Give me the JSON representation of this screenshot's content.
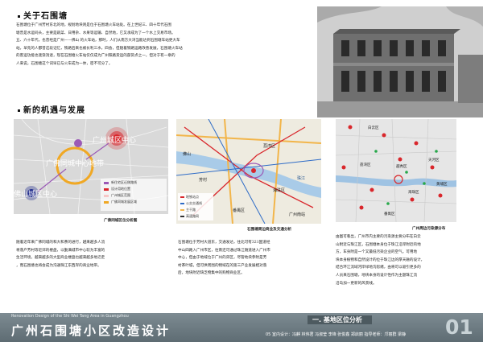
{
  "about": {
    "title": "关于石围塘",
    "paragraph": [
      "石围塘位于广州芳村东北的地，规划地块则是位于石围塘火车站处。在上世纪三、四十年代石围",
      "塘曾是水运码头，主要是蔬菜、日用杂、水果等运输、自然地，它又承成为了一个水上交易市场。",
      "五、六十年代，也曾经是广州——佛山 的火车站，那时，人们从南方大湾当能达到石围塘车站更大车",
      "站，早先的人都曾这段记忆，铁路后来也被长利三水，四会，但随着铁路运路改善发展，石围塘火车站",
      "的客运功能也逐渐消退，现在石围塘火车站仅仅成为广州铁路货运的部货点之一，但对于有一章的",
      "人来说，石围塘这个词早已与火车成为一体，密不可分了。"
    ]
  },
  "development": {
    "title": "新的机遇与发展"
  },
  "map1": {
    "labels": {
      "guangzhou_center": "广州城区中心",
      "foshan_center": "佛山城区中心",
      "belt": "广佛同城中心地带"
    },
    "legend": [
      "新住宅区迁移路线",
      "设计用地位置",
      "广州城区范围",
      "广佛同城发展区域"
    ],
    "caption": "广佛同城区位分析图",
    "colors": {
      "red": "#d9262b",
      "blue": "#1f2a8c",
      "yellow": "#f0a824",
      "purple": "#9b59b6"
    }
  },
  "map2": {
    "labels": [
      "芳村",
      "荔湾区",
      "海珠区",
      "佛山",
      "番禺区",
      "广州南站",
      "珠江"
    ],
    "legend": [
      "地铁站点",
      "公交交通线",
      "主干路",
      "高速路网"
    ],
    "caption": "石围塘周边商业及交通分析"
  },
  "map3": {
    "caption": "广州周边污染源分布",
    "labels": [
      "白云区",
      "荔湾区",
      "越秀区",
      "天河区",
      "海珠区",
      "黄埔区",
      "番禺区"
    ]
  },
  "texts": {
    "col1": [
      "随着近年来广佛同城的和大和茶的进行，越来越多人流",
      "将落户芳村等近郊的楼盘，以勤满城市中心较为丰富的",
      "生活环境，越来越多的大型商业楼盘也越来越多地迁走",
      "，而石围塘也将会成为沟通珠江东西岸的商业地带。"
    ],
    "col2": [
      "石围塘位于芳村大道东，交通发达，往北可有321国道经",
      "中山四路入广州市区，往南还可通过珠江隧道进入广州市",
      "中心，但由于地域位于广州的郊区，尽管地块参附是芳",
      "村茶叶城，但可供周围的物域在的第三产业发展相对落",
      "后，地块附近缺乏物集中的购物商业区。"
    ],
    "col3": [
      "由图可看出，广州市内主要的污染源主要分布在白云",
      "山附近与珠江区，石围塘本身位于珠江沿岸附近的地",
      "方，车身附是一个又最低污染企业的空气。可用地",
      "块本身植物和自然设计的位于珠江边的厚天融的设计，",
      "结合环江流域河岸绿地沟思绪，由将可以吸引更多的",
      "人员来石围塘，地块本身的设计性作为主题珠江流",
      "沿岛加一更新的风景线。"
    ]
  },
  "footer": {
    "title": "广州石围塘小区改造设计",
    "subtitle_en": "Renovation Design of the Shi Wei Tang Area in Guangzhou",
    "tag": "一. 基地区位分析",
    "credits": "05 室内设计：冯麒  林伟君  冯淑莹  李锋  张俊鑫  郑启丽    指导老师：邝丽群  梁静",
    "page": "01"
  }
}
